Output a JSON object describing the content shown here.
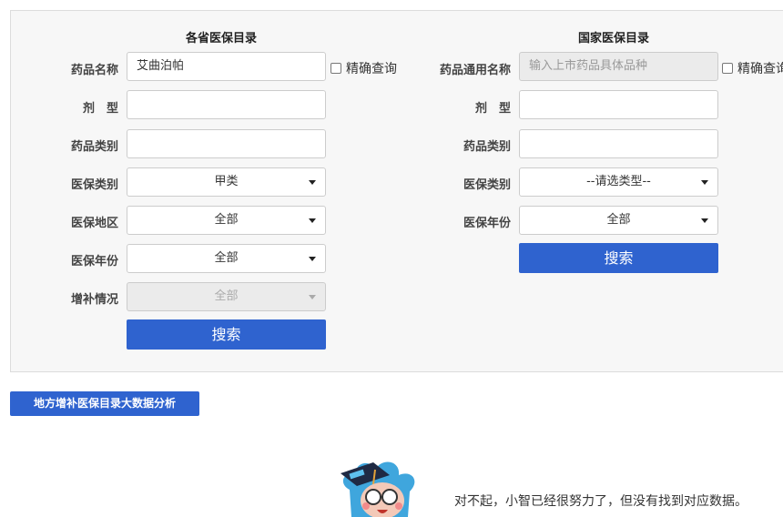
{
  "left": {
    "title": "各省医保目录",
    "drug_name_label": "药品名称",
    "drug_name_value": "艾曲泊帕",
    "exact_label": "精确查询",
    "dosage_label": "剂　型",
    "category_label": "药品类别",
    "insurance_type_label": "医保类别",
    "insurance_type_value": "甲类",
    "region_label": "医保地区",
    "region_value": "全部",
    "year_label": "医保年份",
    "year_value": "全部",
    "supplement_label": "增补情况",
    "supplement_value": "全部",
    "search_label": "搜索"
  },
  "right": {
    "title": "国家医保目录",
    "generic_name_label": "药品通用名称",
    "generic_name_placeholder": "输入上市药品具体品种",
    "exact_label": "精确查询",
    "dosage_label": "剂　型",
    "category_label": "药品类别",
    "insurance_type_label": "医保类别",
    "insurance_type_value": "--请选类型--",
    "year_label": "医保年份",
    "year_value": "全部",
    "search_label": "搜索"
  },
  "analysis_button": "地方增补医保目录大数据分析",
  "empty_message": "对不起，小智已经很努力了，但没有找到对应数据。",
  "colors": {
    "primary": "#2f63cf",
    "panel_bg": "#f7f7f7"
  }
}
